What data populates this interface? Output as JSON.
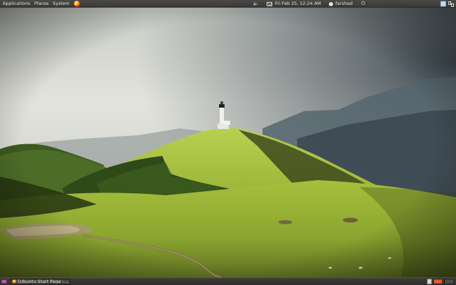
{
  "top_panel": {
    "menus": [
      "Applications",
      "Places",
      "System"
    ],
    "clock": "Fri Feb 25, 12:24 AM",
    "user": "farshad"
  },
  "bottom_panel": {
    "task": {
      "label": "[Ubuntu Start Page - ..."
    }
  },
  "colors": {
    "panel": "#3c3b37",
    "workspace_active": "#dd5a2a",
    "grass": "#a8c23a",
    "sky": "#d9dcd4"
  },
  "icons": {
    "firefox": "firefox-icon",
    "volume": "volume-icon",
    "mail": "mail-icon",
    "user": "user-icon",
    "power": "power-icon"
  }
}
